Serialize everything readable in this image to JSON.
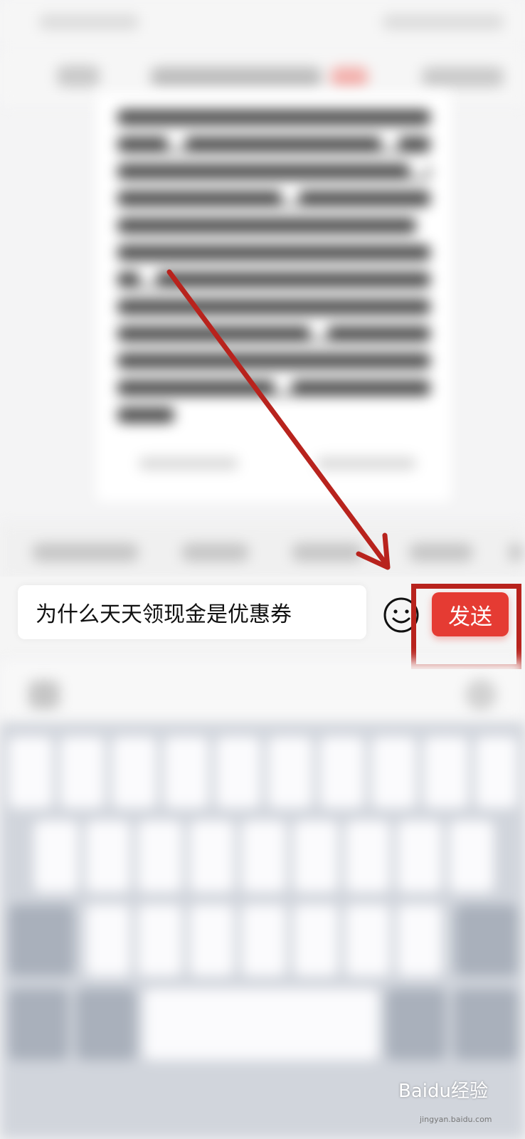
{
  "input": {
    "text": "为什么天天领现金是优惠券"
  },
  "buttons": {
    "send_label": "发送"
  },
  "icons": {
    "emoji": "smiley-face-icon"
  },
  "colors": {
    "send_button": "#e53b33",
    "annotation": "#b8231d"
  },
  "watermark": {
    "brand": "Baidu经验",
    "url": "jingyan.baidu.com"
  }
}
